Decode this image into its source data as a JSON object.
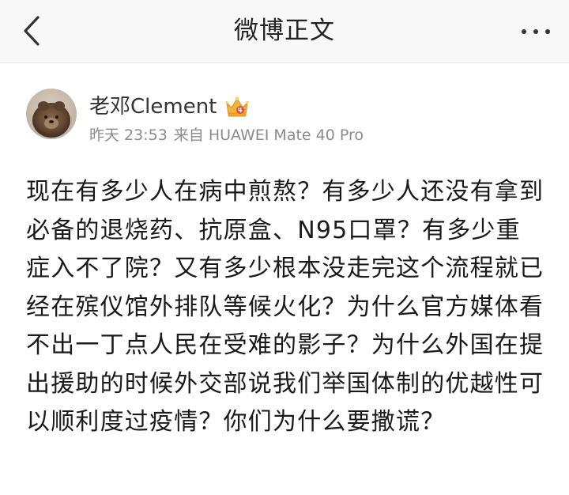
{
  "navbar": {
    "title": "微博正文",
    "back_icon": "chevron-left-icon",
    "more_icon": "more-horizontal-icon"
  },
  "post": {
    "author": {
      "name": "老邓Clement",
      "avatar_icon": "avatar",
      "badge_icon": "vip-crown-icon"
    },
    "meta": {
      "time": "昨天 23:53",
      "source": "来自 HUAWEI Mate 40 Pro"
    },
    "text": "现在有多少人在病中煎熬？有多少人还没有拿到必备的退烧药、抗原盒、N95口罩？有多少重症入不了院？又有多少根本没走完这个流程就已经在殡仪馆外排队等候火化？为什么官方媒体看不出一丁点人民在受难的影子？为什么外国在提出援助的时候外交部说我们举国体制的优越性可以顺利度过疫情？你们为什么要撒谎？"
  },
  "colors": {
    "navbar_bg": "#f8f8f8",
    "text_primary": "#1a1a1a",
    "text_meta": "#8c8c8c",
    "badge_gold": "#f2b43a"
  }
}
